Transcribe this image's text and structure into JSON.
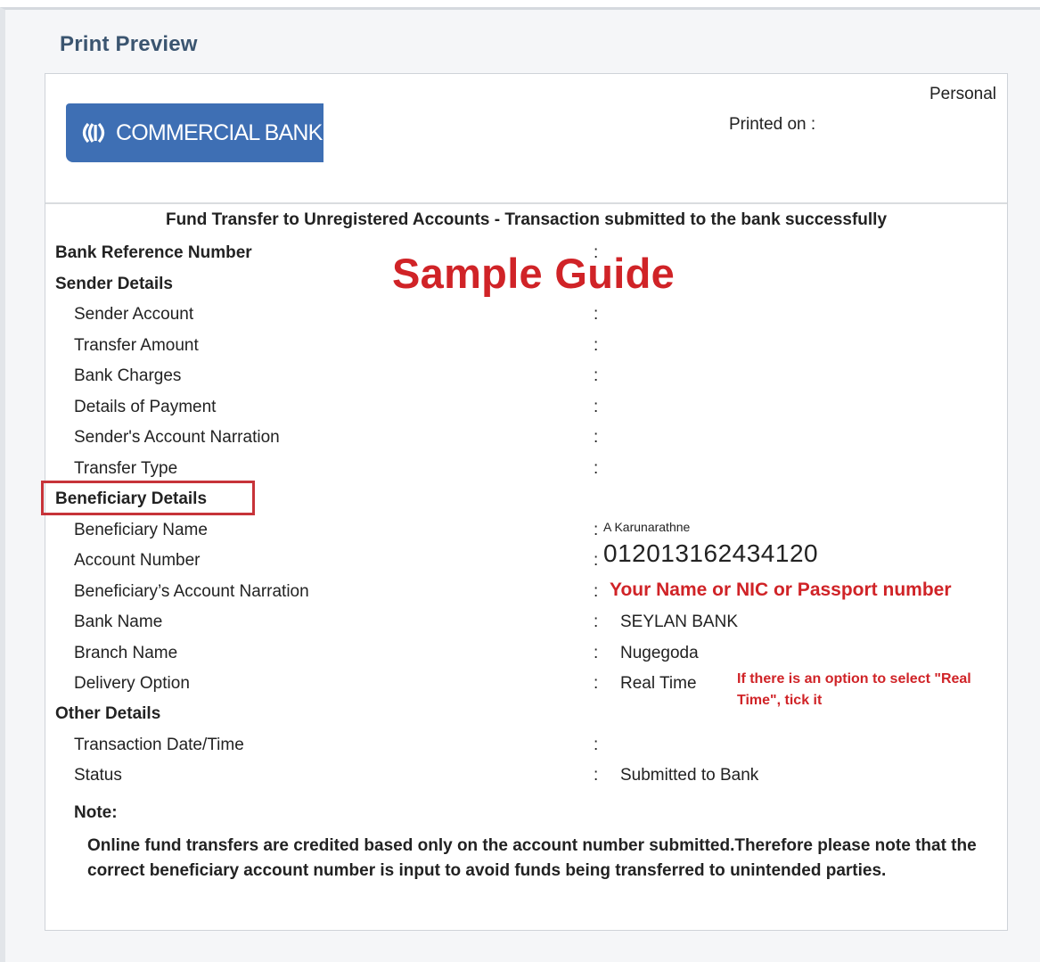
{
  "title": "Print Preview",
  "header": {
    "bank_name": "COMMERCIAL BANK",
    "account_type": "Personal",
    "printed_on_label": "Printed on :"
  },
  "heading": "Fund Transfer to Unregistered Accounts - Transaction submitted to the bank successfully",
  "watermark": "Sample Guide",
  "bank_reference_label": "Bank Reference Number",
  "sender": {
    "section_label": "Sender Details",
    "fields": [
      {
        "label": "Sender Account"
      },
      {
        "label": "Transfer Amount"
      },
      {
        "label": "Bank Charges"
      },
      {
        "label": "Details of Payment"
      },
      {
        "label": "Sender's Account Narration"
      },
      {
        "label": "Transfer Type"
      }
    ]
  },
  "beneficiary": {
    "section_label": "Beneficiary Details",
    "fields": [
      {
        "label": "Beneficiary Name",
        "value": "A Karunarathne"
      },
      {
        "label": "Account Number",
        "value": "012013162434120"
      },
      {
        "label": "Beneficiary’s Account Narration",
        "value": "Your Name or NIC or Passport number"
      },
      {
        "label": "Bank Name",
        "value": "SEYLAN BANK"
      },
      {
        "label": "Branch Name",
        "value": "Nugegoda"
      },
      {
        "label": "Delivery Option",
        "value": "Real Time"
      }
    ],
    "delivery_hint": "If there is an option to select \"Real Time\", tick it"
  },
  "other": {
    "section_label": "Other Details",
    "fields": [
      {
        "label": "Transaction Date/Time",
        "value": ""
      },
      {
        "label": "Status",
        "value": "Submitted to Bank"
      }
    ]
  },
  "note": {
    "label": "Note:",
    "text": "Online fund transfers are credited based only on the account number submitted.Therefore please note that the correct beneficiary account number is input to avoid funds being transferred to unintended parties."
  },
  "colors": {
    "title": "#3b5570",
    "logo_bg": "#3e6fb4",
    "annotation_red": "#d02327",
    "highlight_box": "#c73339"
  }
}
